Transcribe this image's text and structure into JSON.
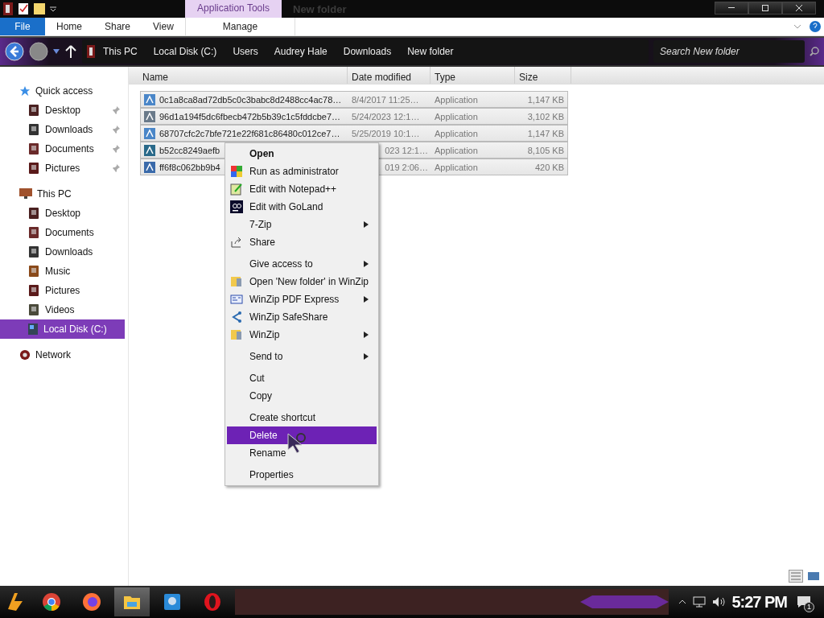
{
  "title_bar": {
    "context_tab": "Application Tools",
    "title": "New folder"
  },
  "ribbon_tabs": [
    {
      "label": "File",
      "kind": "file"
    },
    {
      "label": "Home",
      "kind": "tab"
    },
    {
      "label": "Share",
      "kind": "tab"
    },
    {
      "label": "View",
      "kind": "tab"
    },
    {
      "label": "Manage",
      "kind": "context"
    }
  ],
  "breadcrumb": [
    "This PC",
    "Local Disk (C:)",
    "Users",
    "Audrey Hale",
    "Downloads",
    "New folder"
  ],
  "search": {
    "placeholder": "Search New folder"
  },
  "sidebar": [
    {
      "label": "Quick access",
      "kind": "star",
      "selected": false,
      "children": [
        {
          "label": "Desktop",
          "kind": "desktop",
          "pinned": true,
          "selected": false
        },
        {
          "label": "Downloads",
          "kind": "download",
          "pinned": true,
          "selected": false
        },
        {
          "label": "Documents",
          "kind": "docs",
          "pinned": true,
          "selected": false
        },
        {
          "label": "Pictures",
          "kind": "pictures",
          "pinned": true,
          "selected": false
        }
      ]
    },
    {
      "label": "This PC",
      "kind": "pc",
      "selected": false,
      "children": [
        {
          "label": "Desktop",
          "kind": "desktop",
          "pinned": false,
          "selected": false
        },
        {
          "label": "Documents",
          "kind": "docs",
          "pinned": false,
          "selected": false
        },
        {
          "label": "Downloads",
          "kind": "download",
          "pinned": false,
          "selected": false
        },
        {
          "label": "Music",
          "kind": "music",
          "pinned": false,
          "selected": false
        },
        {
          "label": "Pictures",
          "kind": "pictures",
          "pinned": false,
          "selected": false
        },
        {
          "label": "Videos",
          "kind": "videos",
          "pinned": false,
          "selected": false
        },
        {
          "label": "Local Disk (C:)",
          "kind": "disk",
          "pinned": false,
          "selected": true
        }
      ]
    },
    {
      "label": "Network",
      "kind": "network",
      "selected": false
    }
  ],
  "table": {
    "columns": [
      "Name",
      "Date modified",
      "Type",
      "Size"
    ],
    "rows": [
      {
        "kind": "full",
        "selected": true,
        "name": "0c1a8ca8ad72db5c0c3babc8d2488cc4ac78…",
        "date": "8/4/2017 11:25…",
        "type": "Application",
        "size": "1,147 KB"
      },
      {
        "kind": "full",
        "selected": true,
        "name": "96d1a194f5dc6fbecb472b5b39c1c5fddcbe7…",
        "date": "5/24/2023 12:1…",
        "type": "Application",
        "size": "3,102 KB"
      },
      {
        "kind": "full",
        "selected": true,
        "name": "68707cfc2c7bfe721e22f681c86480c012ce7…",
        "date": "5/25/2019 10:1…",
        "type": "Application",
        "size": "1,147 KB"
      },
      {
        "kind": "covered",
        "selected": true,
        "name": "b52cc8249aefb",
        "date": "023 12:1…",
        "type": "Application",
        "size": "8,105 KB"
      },
      {
        "kind": "covered",
        "selected": true,
        "name": "ff6f8c062bb9b4",
        "date": "019 2:06…",
        "type": "Application",
        "size": "420 KB"
      }
    ]
  },
  "context_menu": [
    [
      {
        "label": "Open",
        "bold": true,
        "submenu": false,
        "selected": false
      },
      {
        "label": "Run as administrator",
        "kind": "shield",
        "bold": false,
        "submenu": false,
        "selected": false
      },
      {
        "label": "Edit with Notepad++",
        "kind": "notepad",
        "bold": false,
        "submenu": false,
        "selected": false
      },
      {
        "label": "Edit with GoLand",
        "kind": "goland",
        "bold": false,
        "submenu": false,
        "selected": false
      },
      {
        "label": "7-Zip",
        "bold": false,
        "submenu": true,
        "selected": false
      },
      {
        "label": "Share",
        "kind": "share",
        "bold": false,
        "submenu": false,
        "selected": false
      }
    ],
    [
      {
        "label": "Give access to",
        "bold": false,
        "submenu": true,
        "selected": false
      },
      {
        "label": "Open 'New folder' in WinZip",
        "kind": "winzip",
        "bold": false,
        "submenu": false,
        "selected": false
      },
      {
        "label": "WinZip PDF Express",
        "kind": "pdf",
        "bold": false,
        "submenu": true,
        "selected": false
      },
      {
        "label": "WinZip SafeShare",
        "kind": "safeshare",
        "bold": false,
        "submenu": false,
        "selected": false
      },
      {
        "label": "WinZip",
        "kind": "winzip",
        "bold": false,
        "submenu": true,
        "selected": false
      }
    ],
    [
      {
        "label": "Send to",
        "bold": false,
        "submenu": true,
        "selected": false
      }
    ],
    [
      {
        "label": "Cut",
        "bold": false,
        "submenu": false,
        "selected": false
      },
      {
        "label": "Copy",
        "bold": false,
        "submenu": false,
        "selected": false
      }
    ],
    [
      {
        "label": "Create shortcut",
        "bold": false,
        "submenu": false,
        "selected": false
      },
      {
        "label": "Delete",
        "bold": false,
        "submenu": false,
        "selected": true
      },
      {
        "label": "Rename",
        "bold": false,
        "submenu": false,
        "selected": false
      }
    ],
    [
      {
        "label": "Properties",
        "bold": false,
        "submenu": false,
        "selected": false
      }
    ]
  ],
  "taskbar": {
    "apps": [
      {
        "kind": "chrome",
        "selected": false
      },
      {
        "kind": "firefox",
        "selected": false
      },
      {
        "kind": "explorer",
        "selected": true
      },
      {
        "kind": "photos",
        "selected": false
      },
      {
        "kind": "opera",
        "selected": false
      }
    ],
    "clock": "5:27 PM",
    "notifications": "1"
  }
}
